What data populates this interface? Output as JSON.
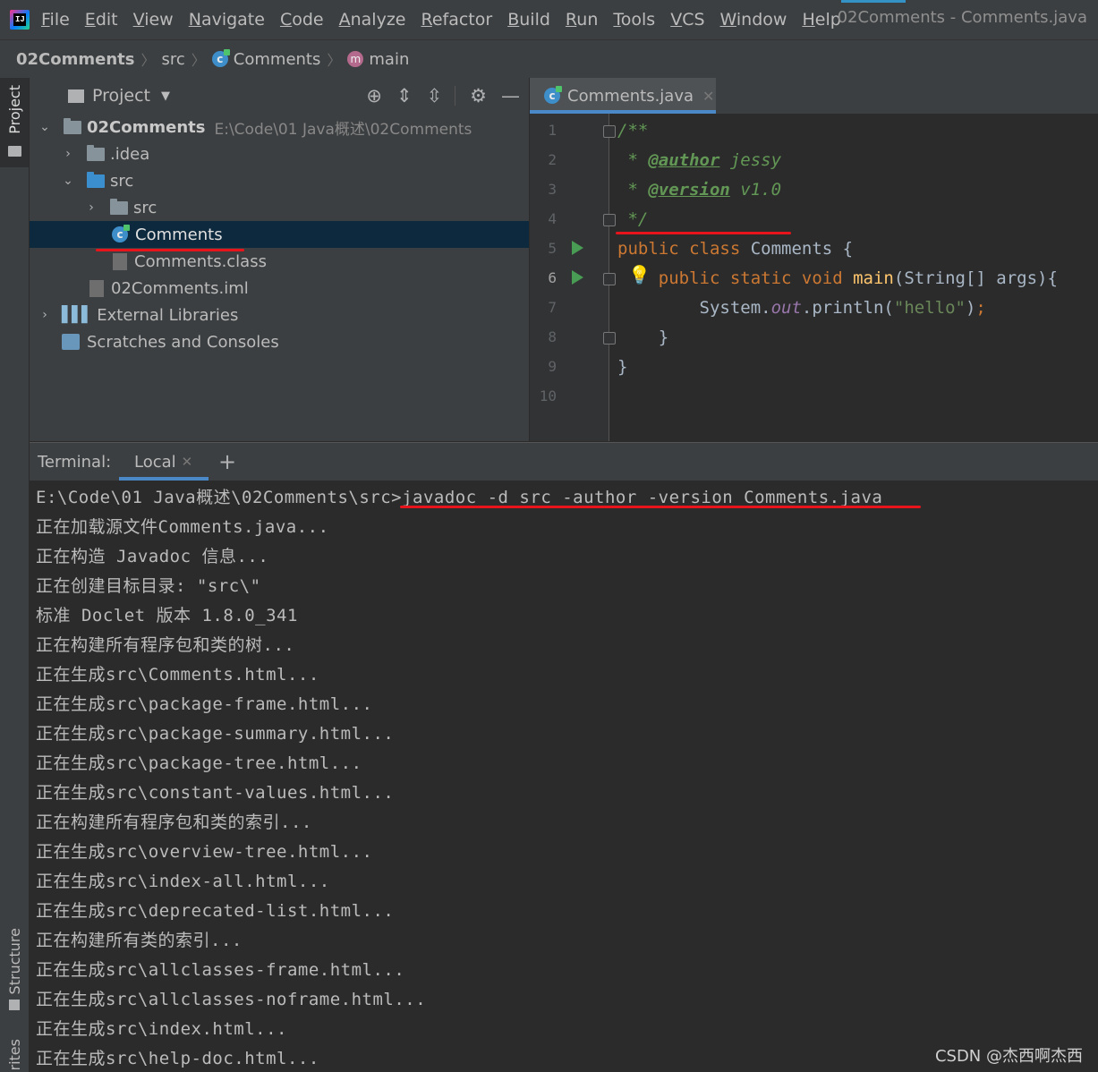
{
  "menubar": {
    "logo_text": "IJ",
    "items": [
      "File",
      "Edit",
      "View",
      "Navigate",
      "Code",
      "Analyze",
      "Refactor",
      "Build",
      "Run",
      "Tools",
      "VCS",
      "Window",
      "Help"
    ],
    "window_title": "02Comments - Comments.java"
  },
  "navbar": {
    "project": "02Comments",
    "folder": "src",
    "class": "Comments",
    "method": "main",
    "class_icon_letter": "c",
    "method_icon_letter": "m"
  },
  "left_strip": {
    "project_label": "Project",
    "structure_label": "Structure",
    "favorites_label": "rites"
  },
  "project_panel": {
    "title": "Project",
    "tree": [
      {
        "label": "02Comments",
        "path": "E:\\Code\\01 Java概述\\02Comments"
      },
      {
        "label": ".idea"
      },
      {
        "label": "src"
      },
      {
        "label": "src"
      },
      {
        "label": "Comments"
      },
      {
        "label": "Comments.class"
      },
      {
        "label": "02Comments.iml"
      },
      {
        "label": "External Libraries"
      },
      {
        "label": "Scratches and Consoles"
      }
    ]
  },
  "editor": {
    "tab_label": "Comments.java",
    "line_numbers": [
      "1",
      "2",
      "3",
      "4",
      "5",
      "6",
      "7",
      "8",
      "9",
      "10"
    ],
    "code": {
      "l1": "/**",
      "l2_star": " * ",
      "l2_tag": "@author",
      "l2_val": " jessy",
      "l3_star": " * ",
      "l3_tag": "@version",
      "l3_val": " v1.0",
      "l4": " */",
      "l5_kw": "public class",
      "l5_rest": " Comments {",
      "l6_indent": "    ",
      "l6_kw": "public static void",
      "l6_fn": " main",
      "l6_rest": "(String[] args){",
      "l7_a": "        System.",
      "l7_field": "out",
      "l7_b": ".println(",
      "l7_str": "\"hello\"",
      "l7_c": ")",
      "l7_semi": ";",
      "l8": "    }",
      "l9": "}"
    }
  },
  "terminal": {
    "label": "Terminal:",
    "tab": "Local",
    "add": "+",
    "lines": [
      "E:\\Code\\01 Java概述\\02Comments\\src>javadoc -d src -author -version Comments.java",
      "正在加载源文件Comments.java...",
      "正在构造 Javadoc 信息...",
      "正在创建目标目录: \"src\\\"",
      "标准 Doclet 版本 1.8.0_341",
      "正在构建所有程序包和类的树...",
      "正在生成src\\Comments.html...",
      "正在生成src\\package-frame.html...",
      "正在生成src\\package-summary.html...",
      "正在生成src\\package-tree.html...",
      "正在生成src\\constant-values.html...",
      "正在构建所有程序包和类的索引...",
      "正在生成src\\overview-tree.html...",
      "正在生成src\\index-all.html...",
      "正在生成src\\deprecated-list.html...",
      "正在构建所有类的索引...",
      "正在生成src\\allclasses-frame.html...",
      "正在生成src\\allclasses-noframe.html...",
      "正在生成src\\index.html...",
      "正在生成src\\help-doc.html..."
    ]
  },
  "watermark": "CSDN @杰西啊杰西",
  "colors": {
    "annotation_red": "#e8141c",
    "keyword": "#cc7832",
    "comment": "#629755",
    "string": "#6a8759",
    "function": "#ffc66d"
  }
}
